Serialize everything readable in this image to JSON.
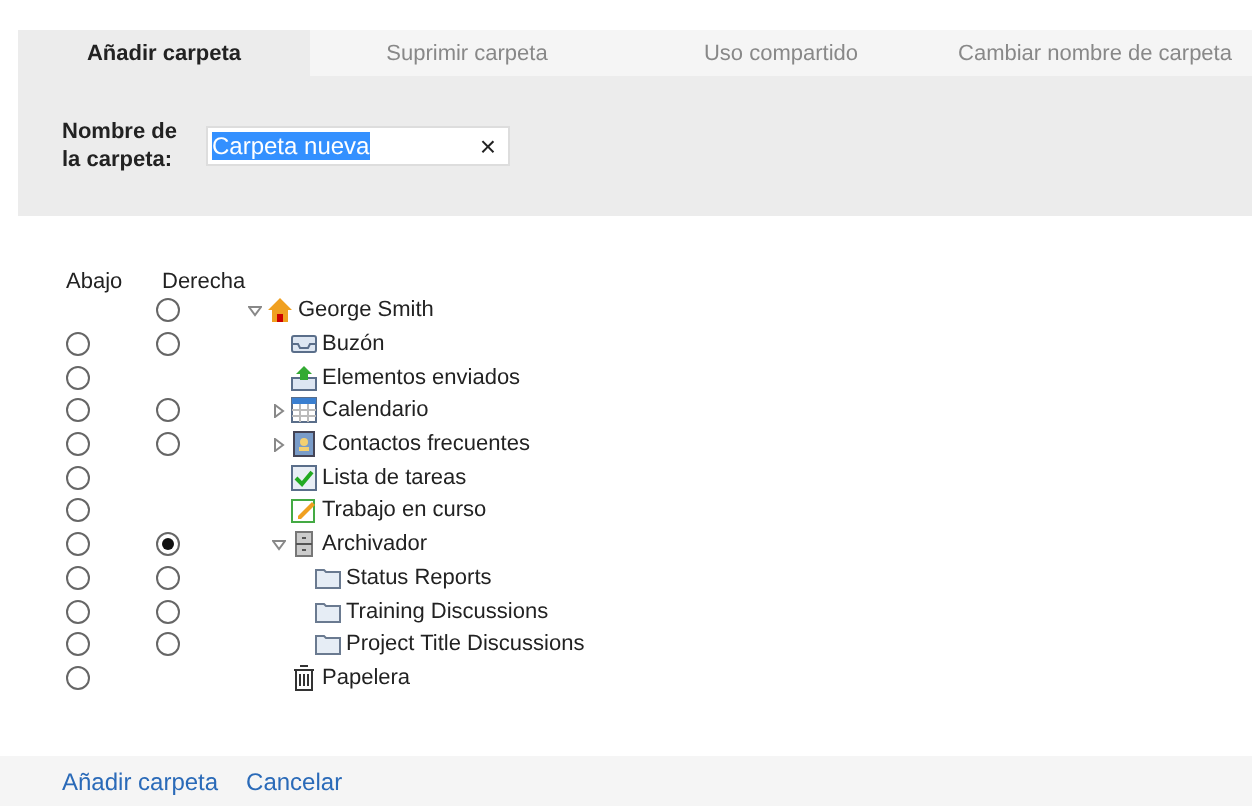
{
  "tabs": [
    {
      "label": "Añadir carpeta",
      "selected": true
    },
    {
      "label": "Suprimir carpeta",
      "selected": false
    },
    {
      "label": "Uso compartido",
      "selected": false
    },
    {
      "label": "Cambiar nombre de carpeta",
      "selected": false
    }
  ],
  "name_field": {
    "label": "Nombre de la carpeta:",
    "value": "Carpeta nueva",
    "clear": "×"
  },
  "columns": {
    "below": "Abajo",
    "right": "Derecha"
  },
  "tree": [
    {
      "label": "George Smith",
      "kind": "home",
      "expanded": true,
      "right": {
        "selected": false
      },
      "children": [
        {
          "label": "Buzón",
          "kind": "inbox",
          "below": {
            "selected": false
          },
          "right": {
            "selected": false
          }
        },
        {
          "label": "Elementos enviados",
          "kind": "sent",
          "below": {
            "selected": false
          }
        },
        {
          "label": "Calendario",
          "kind": "calendar",
          "expanded": false,
          "below": {
            "selected": false
          },
          "right": {
            "selected": false
          }
        },
        {
          "label": "Contactos frecuentes",
          "kind": "contacts",
          "expanded": false,
          "below": {
            "selected": false
          },
          "right": {
            "selected": false
          }
        },
        {
          "label": "Lista de tareas",
          "kind": "tasks",
          "below": {
            "selected": false
          }
        },
        {
          "label": "Trabajo en curso",
          "kind": "drafts",
          "below": {
            "selected": false
          }
        },
        {
          "label": "Archivador",
          "kind": "cabinet",
          "expanded": true,
          "below": {
            "selected": false
          },
          "right": {
            "selected": true
          },
          "children": [
            {
              "label": "Status Reports",
              "kind": "folder",
              "below": {
                "selected": false
              },
              "right": {
                "selected": false
              }
            },
            {
              "label": "Training Discussions",
              "kind": "folder",
              "below": {
                "selected": false
              },
              "right": {
                "selected": false
              }
            },
            {
              "label": "Project Title Discussions",
              "kind": "folder",
              "below": {
                "selected": false
              },
              "right": {
                "selected": false
              }
            }
          ]
        },
        {
          "label": "Papelera",
          "kind": "trash",
          "below": {
            "selected": false
          }
        }
      ]
    }
  ],
  "footer": [
    "Añadir carpeta",
    "Cancelar"
  ]
}
